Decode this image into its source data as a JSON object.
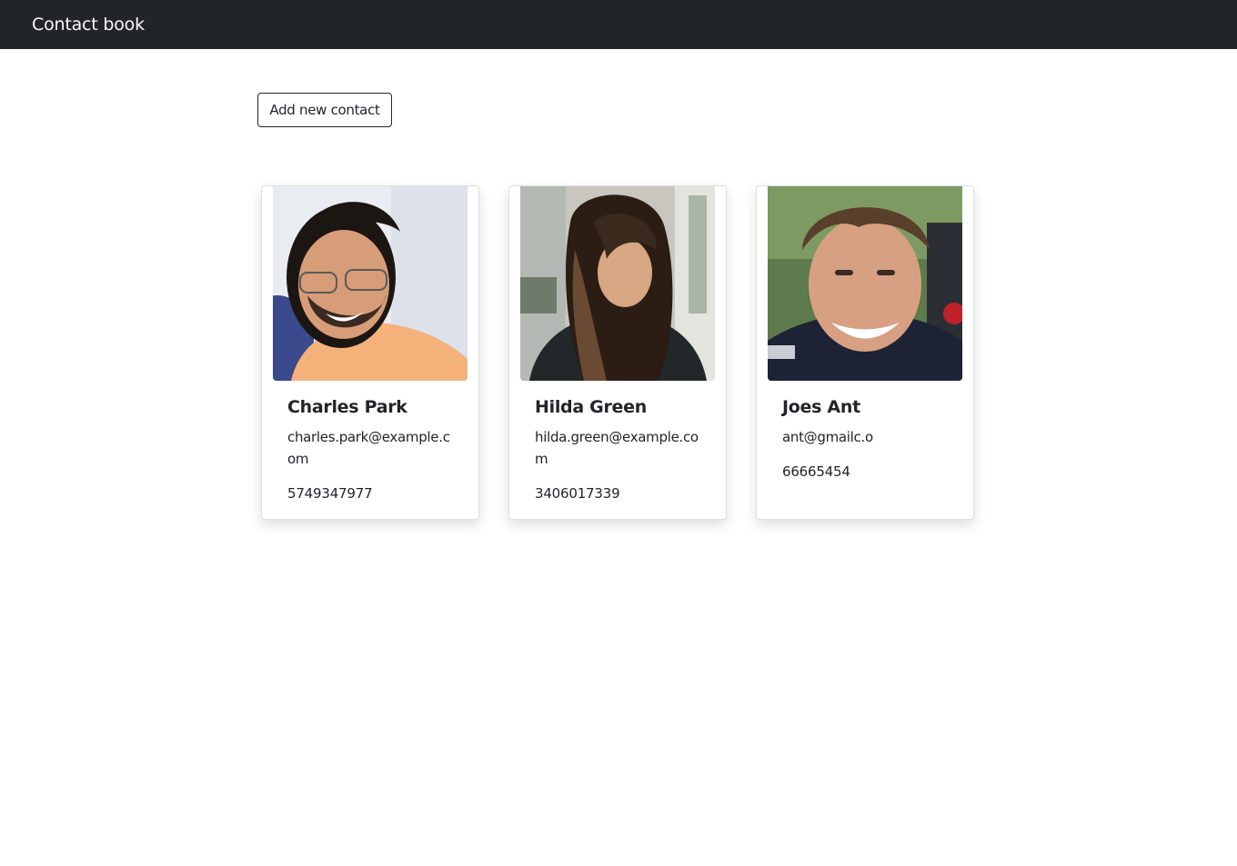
{
  "navbar": {
    "brand": "Contact book"
  },
  "actions": {
    "add_label": "Add new contact"
  },
  "contacts": [
    {
      "name": "Charles Park",
      "email": "charles.park@example.com",
      "phone": "5749347977",
      "photo_icon": "portrait-photo"
    },
    {
      "name": "Hilda Green",
      "email": "hilda.green@example.com",
      "phone": "3406017339",
      "photo_icon": "portrait-photo"
    },
    {
      "name": "Joes Ant",
      "email": "ant@gmailc.o",
      "phone": "66665454",
      "photo_icon": "portrait-photo"
    }
  ]
}
